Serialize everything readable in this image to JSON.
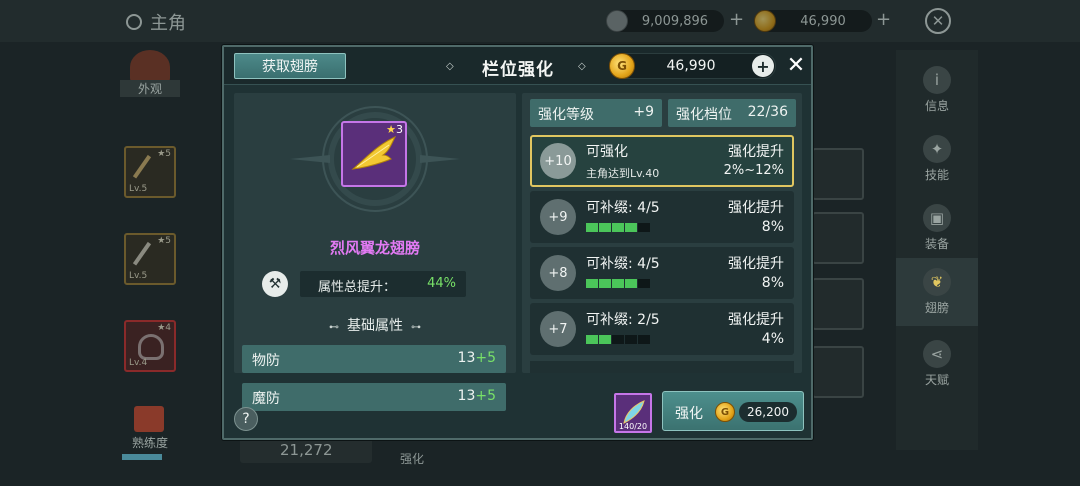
{
  "background": {
    "title": "主角",
    "silver_value": "9,009,896",
    "gold_value": "46,990",
    "plus": "+",
    "close": "✕",
    "left_labels": [
      "外观",
      "熟练度"
    ],
    "slot_levels": [
      "Lv.5",
      "Lv.5",
      "Lv.4"
    ],
    "slot_stars": [
      "5",
      "5",
      "4"
    ],
    "right_nav": [
      {
        "label": "信息",
        "icon": "info-icon"
      },
      {
        "label": "技能",
        "icon": "skill-icon"
      },
      {
        "label": "装备",
        "icon": "equipment-icon"
      },
      {
        "label": "翅膀",
        "icon": "wing-icon"
      },
      {
        "label": "天赋",
        "icon": "talent-icon"
      }
    ],
    "bottom_value": "21,272",
    "bottom_label": "强化"
  },
  "modal": {
    "obtain_button": "获取翅膀",
    "title": "栏位强化",
    "gold_value": "46,990",
    "gold_plus": "+",
    "close": "✕",
    "item": {
      "name": "烈风翼龙翅膀",
      "stars": "3",
      "rarity_color": "#c576e8"
    },
    "total_boost_label": "属性总提升：",
    "total_boost_value": "44%",
    "base_attr_title": "基础属性",
    "stats": [
      {
        "label": "物防",
        "base": "13",
        "bonus": "+5"
      },
      {
        "label": "魔防",
        "base": "13",
        "bonus": "+5"
      }
    ],
    "enhance_level_label": "强化等级",
    "enhance_level_value": "+9",
    "enhance_tier_label": "强化档位",
    "enhance_tier_value": "22/36",
    "levels": [
      {
        "badge": "+10",
        "title": "可强化",
        "sub": "主角达到Lv.40",
        "right1": "强化提升",
        "right2": "2%~12%",
        "active": true
      },
      {
        "badge": "+9",
        "title": "可补缀: 4/5",
        "right1": "强化提升",
        "right2": "8%",
        "filled": 4,
        "total": 5
      },
      {
        "badge": "+8",
        "title": "可补缀: 4/5",
        "right1": "强化提升",
        "right2": "8%",
        "filled": 4,
        "total": 5
      },
      {
        "badge": "+7",
        "title": "可补缀: 2/5",
        "right1": "强化提升",
        "right2": "4%",
        "filled": 2,
        "total": 5
      }
    ],
    "help": "?",
    "material_count": "140/20",
    "enhance_button": "强化",
    "enhance_cost": "26,200",
    "coin_letter": "G",
    "deco_glyph": "◇"
  },
  "colors": {
    "accent_green": "#78e068",
    "rarity_purple": "#c576e8",
    "active_border": "#e0c660",
    "progress_green": "#4bc55a"
  }
}
